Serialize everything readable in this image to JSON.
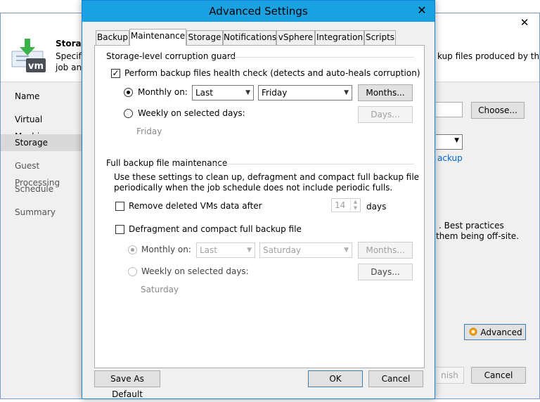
{
  "background_window": {
    "close_label": "✕",
    "header_title": "Storage",
    "header_desc_line1": "Specify",
    "header_desc_line2": "job and",
    "header_desc_right": "kup files produced by this",
    "nav": [
      "Name",
      "Virtual Machines",
      "Storage",
      "Guest Processing",
      "Schedule",
      "Summary"
    ],
    "choose_button": "Choose...",
    "link_text": "ackup",
    "note_line1": ". Best practices",
    "note_line2": "them being off-site.",
    "advanced_button": "Advanced",
    "finish_button": "nish",
    "cancel_button": "Cancel"
  },
  "dialog": {
    "title": "Advanced Settings",
    "close_label": "✕",
    "tabs": [
      "Backup",
      "Maintenance",
      "Storage",
      "Notifications",
      "vSphere",
      "Integration",
      "Scripts"
    ],
    "active_tab": "Maintenance",
    "corruption_guard": {
      "heading": "Storage-level corruption guard",
      "health_check_label": "Perform backup files health check (detects and auto-heals corruption)",
      "health_check_checked": true,
      "monthly_label": "Monthly on:",
      "monthly_week": "Last",
      "monthly_day": "Friday",
      "months_button": "Months...",
      "weekly_label": "Weekly on selected days:",
      "days_button": "Days...",
      "weekly_days": "Friday"
    },
    "full_backup": {
      "heading": "Full backup file maintenance",
      "desc_line1": "Use these settings to clean up, defragment and compact full backup file",
      "desc_line2": "periodically when the job schedule does not include periodic fulls.",
      "remove_label": "Remove deleted VMs data after",
      "remove_days_value": "14",
      "days_unit": "days",
      "defrag_label": "Defragment and compact full backup file",
      "monthly_label": "Monthly on:",
      "monthly_week": "Last",
      "monthly_day": "Saturday",
      "months_button": "Months...",
      "weekly_label": "Weekly on selected days:",
      "days_button": "Days...",
      "weekly_days": "Saturday"
    },
    "save_default_button": "Save As Default",
    "ok_button": "OK",
    "cancel_button": "Cancel"
  },
  "colors": {
    "dialog_titlebar": "#1aa1e2",
    "window_border": "#0f83d7",
    "link": "#0066cc"
  }
}
